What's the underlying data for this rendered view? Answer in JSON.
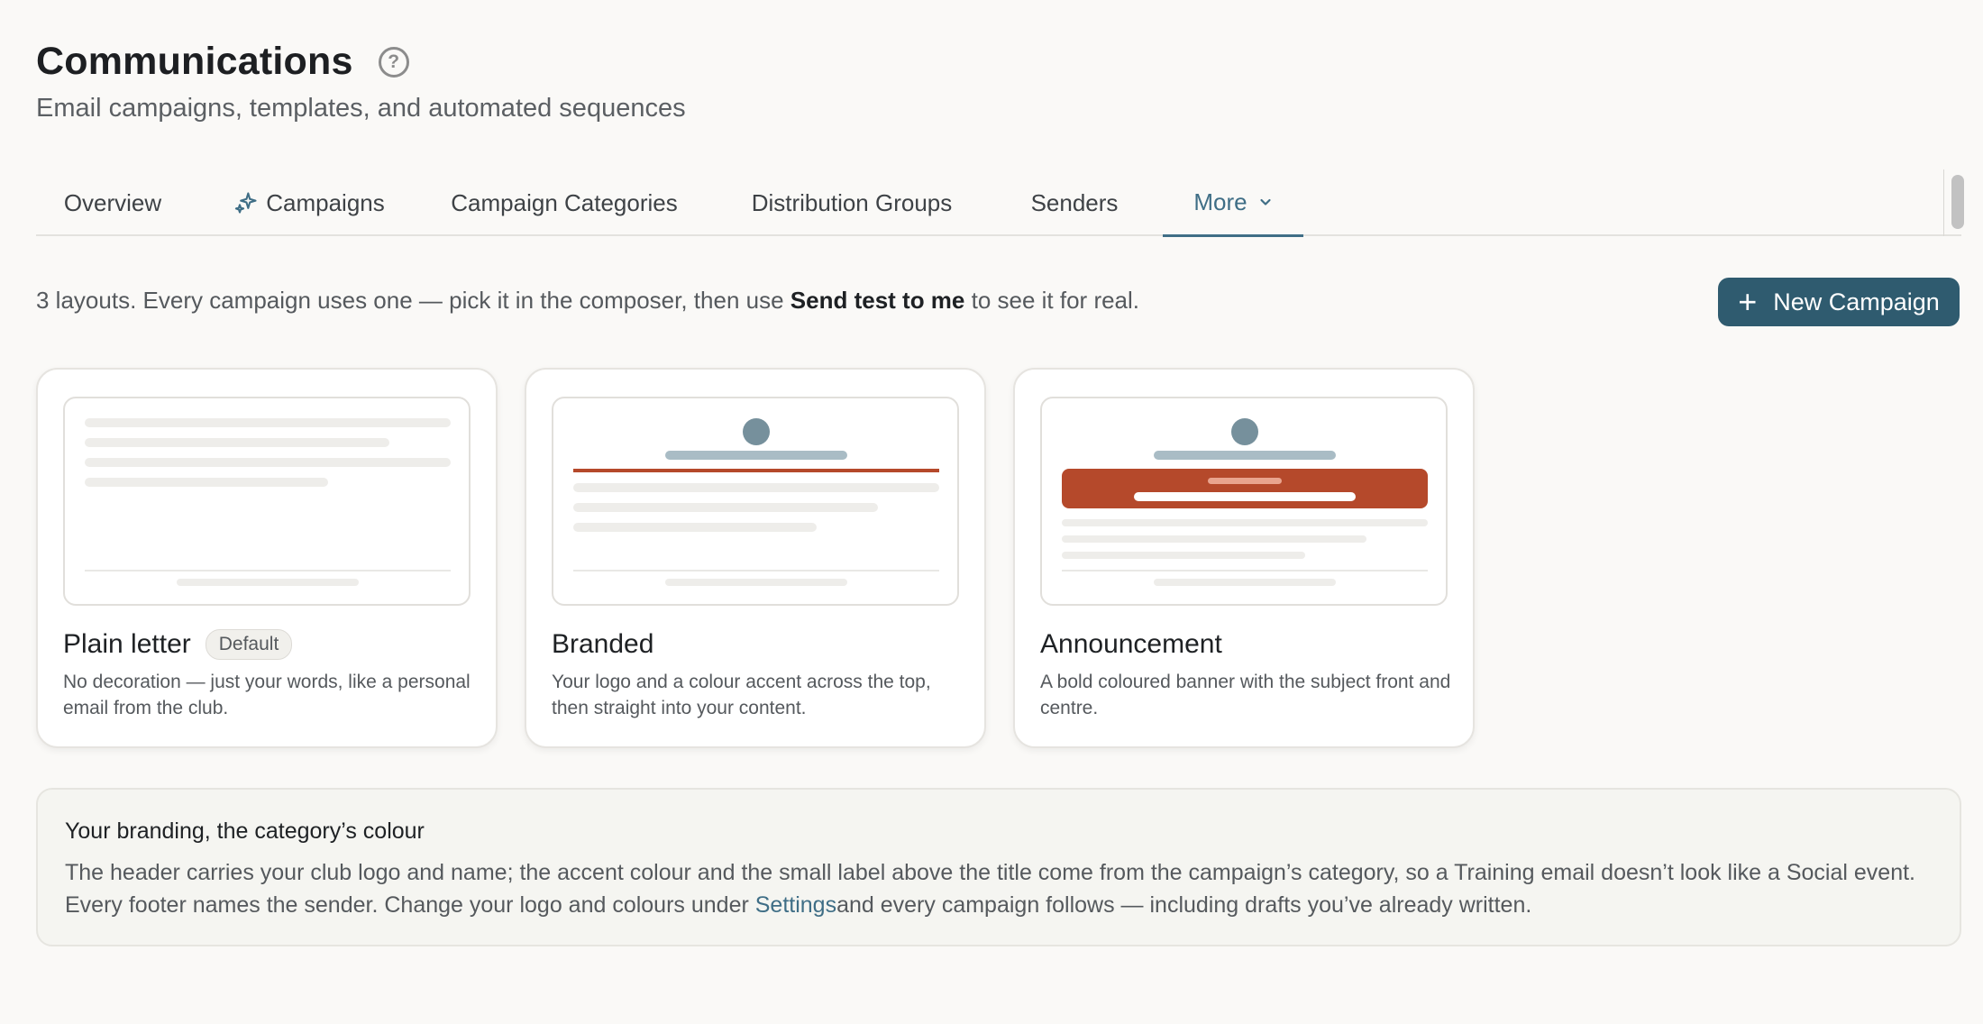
{
  "header": {
    "title": "Communications",
    "help_icon": "?",
    "subtitle": "Email campaigns, templates, and automated sequences"
  },
  "tabs": [
    {
      "label": "Overview",
      "icon": null,
      "active": false
    },
    {
      "label": "Campaigns",
      "icon": "sparkle-icon",
      "active": false
    },
    {
      "label": "Campaign Categories",
      "icon": null,
      "active": false
    },
    {
      "label": "Distribution Groups",
      "icon": null,
      "active": false
    },
    {
      "label": "Senders",
      "icon": null,
      "active": false
    },
    {
      "label": "More",
      "icon": "chevron-down-icon",
      "active": true
    }
  ],
  "intro": {
    "before": "3 layouts. Every campaign uses one — pick it in the composer, then use ",
    "emphasis": "Send test to me",
    "after": " to see it for real."
  },
  "new_campaign": {
    "plus": "+",
    "label": "New Campaign"
  },
  "layouts": [
    {
      "title": "Plain letter",
      "badge": "Default",
      "description": "No decoration — just your words, like a personal email from the club."
    },
    {
      "title": "Branded",
      "badge": "",
      "description": "Your logo and a colour accent across the top, then straight into your content."
    },
    {
      "title": "Announcement",
      "badge": "",
      "description": "A bold coloured banner with the subject front and centre."
    }
  ],
  "note": {
    "title": "Your branding, the category’s colour",
    "body_before": "The header carries your club logo and name; the accent colour and the small label above the title come from the campaign’s category, so a Training email doesn’t look like a Social event. Every footer names the sender. Change your logo and colours under ",
    "link": "Settings",
    "body_after": "and every campaign follows — including drafts you’ve already written."
  },
  "colors": {
    "accent": "#3f6e86",
    "button": "#2f5b6f",
    "banner": "#b5492b"
  }
}
